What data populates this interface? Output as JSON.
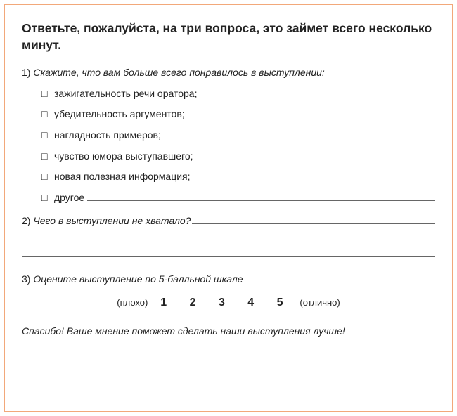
{
  "title": "Ответьте, пожалуйста, на три вопроса, это займет всего несколько минут.",
  "q1": {
    "num": "1)",
    "text": "Скажите, что вам больше всего понравилось в выступлении:",
    "options": [
      "зажигательность речи оратора;",
      "убедительность аргументов;",
      "наглядность примеров;",
      "чувство юмора выступавшего;",
      "новая полезная информация;"
    ],
    "other_label": "другое"
  },
  "q2": {
    "num": "2)",
    "text": "Чего в выступлении не хватало?"
  },
  "q3": {
    "num": "3)",
    "text": "Оцените выступление по 5-балльной шкале",
    "low": "(плохо)",
    "high": "(отлично)",
    "scale": "1  2  3  4  5"
  },
  "thanks": "Спасибо! Ваше мнение поможет сделать наши выступления лучше!",
  "checkbox_glyph": "□"
}
